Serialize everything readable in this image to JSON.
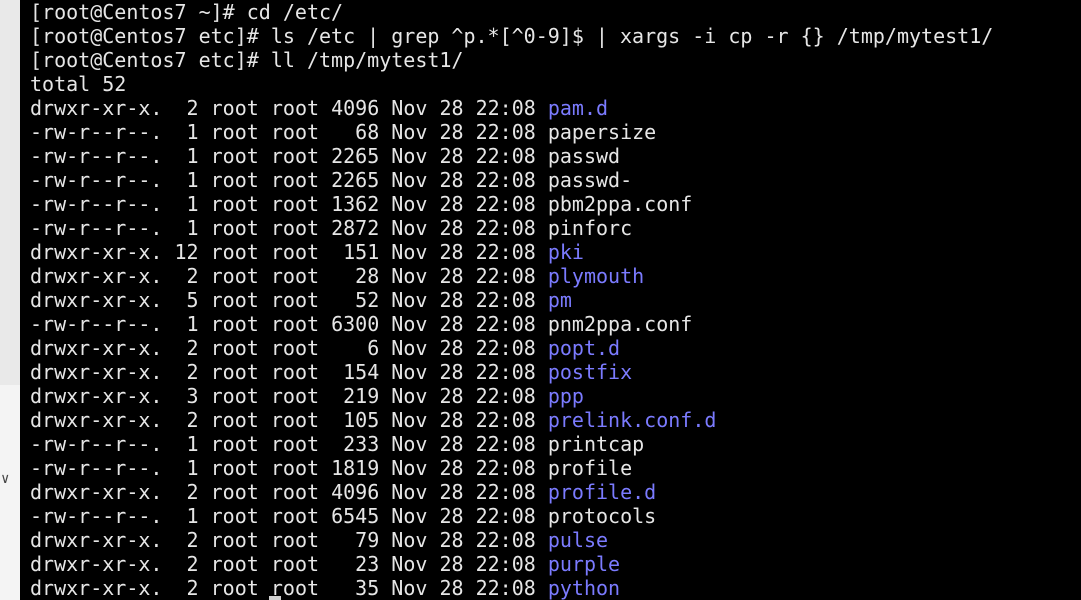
{
  "terminal": {
    "commands": [
      "[root@Centos7 ~]# cd /etc/",
      "[root@Centos7 etc]# ls /etc | grep ^p.*[^0-9]$ | xargs -i cp -r {} /tmp/mytest1/",
      "[root@Centos7 etc]# ll /tmp/mytest1/"
    ],
    "total": "total 52",
    "listing": [
      {
        "perm": "drwxr-xr-x.",
        "links": "2",
        "owner": "root",
        "group": "root",
        "size": "4096",
        "date": "Nov 28 22:08",
        "name": "pam.d",
        "type": "dir"
      },
      {
        "perm": "-rw-r--r--.",
        "links": "1",
        "owner": "root",
        "group": "root",
        "size": "68",
        "date": "Nov 28 22:08",
        "name": "papersize",
        "type": "file"
      },
      {
        "perm": "-rw-r--r--.",
        "links": "1",
        "owner": "root",
        "group": "root",
        "size": "2265",
        "date": "Nov 28 22:08",
        "name": "passwd",
        "type": "file"
      },
      {
        "perm": "-rw-r--r--.",
        "links": "1",
        "owner": "root",
        "group": "root",
        "size": "2265",
        "date": "Nov 28 22:08",
        "name": "passwd-",
        "type": "file"
      },
      {
        "perm": "-rw-r--r--.",
        "links": "1",
        "owner": "root",
        "group": "root",
        "size": "1362",
        "date": "Nov 28 22:08",
        "name": "pbm2ppa.conf",
        "type": "file"
      },
      {
        "perm": "-rw-r--r--.",
        "links": "1",
        "owner": "root",
        "group": "root",
        "size": "2872",
        "date": "Nov 28 22:08",
        "name": "pinforc",
        "type": "file"
      },
      {
        "perm": "drwxr-xr-x.",
        "links": "12",
        "owner": "root",
        "group": "root",
        "size": "151",
        "date": "Nov 28 22:08",
        "name": "pki",
        "type": "dir"
      },
      {
        "perm": "drwxr-xr-x.",
        "links": "2",
        "owner": "root",
        "group": "root",
        "size": "28",
        "date": "Nov 28 22:08",
        "name": "plymouth",
        "type": "dir"
      },
      {
        "perm": "drwxr-xr-x.",
        "links": "5",
        "owner": "root",
        "group": "root",
        "size": "52",
        "date": "Nov 28 22:08",
        "name": "pm",
        "type": "dir"
      },
      {
        "perm": "-rw-r--r--.",
        "links": "1",
        "owner": "root",
        "group": "root",
        "size": "6300",
        "date": "Nov 28 22:08",
        "name": "pnm2ppa.conf",
        "type": "file"
      },
      {
        "perm": "drwxr-xr-x.",
        "links": "2",
        "owner": "root",
        "group": "root",
        "size": "6",
        "date": "Nov 28 22:08",
        "name": "popt.d",
        "type": "dir"
      },
      {
        "perm": "drwxr-xr-x.",
        "links": "2",
        "owner": "root",
        "group": "root",
        "size": "154",
        "date": "Nov 28 22:08",
        "name": "postfix",
        "type": "dir"
      },
      {
        "perm": "drwxr-xr-x.",
        "links": "3",
        "owner": "root",
        "group": "root",
        "size": "219",
        "date": "Nov 28 22:08",
        "name": "ppp",
        "type": "dir"
      },
      {
        "perm": "drwxr-xr-x.",
        "links": "2",
        "owner": "root",
        "group": "root",
        "size": "105",
        "date": "Nov 28 22:08",
        "name": "prelink.conf.d",
        "type": "dir"
      },
      {
        "perm": "-rw-r--r--.",
        "links": "1",
        "owner": "root",
        "group": "root",
        "size": "233",
        "date": "Nov 28 22:08",
        "name": "printcap",
        "type": "file"
      },
      {
        "perm": "-rw-r--r--.",
        "links": "1",
        "owner": "root",
        "group": "root",
        "size": "1819",
        "date": "Nov 28 22:08",
        "name": "profile",
        "type": "file"
      },
      {
        "perm": "drwxr-xr-x.",
        "links": "2",
        "owner": "root",
        "group": "root",
        "size": "4096",
        "date": "Nov 28 22:08",
        "name": "profile.d",
        "type": "dir"
      },
      {
        "perm": "-rw-r--r--.",
        "links": "1",
        "owner": "root",
        "group": "root",
        "size": "6545",
        "date": "Nov 28 22:08",
        "name": "protocols",
        "type": "file"
      },
      {
        "perm": "drwxr-xr-x.",
        "links": "2",
        "owner": "root",
        "group": "root",
        "size": "79",
        "date": "Nov 28 22:08",
        "name": "pulse",
        "type": "dir"
      },
      {
        "perm": "drwxr-xr-x.",
        "links": "2",
        "owner": "root",
        "group": "root",
        "size": "23",
        "date": "Nov 28 22:08",
        "name": "purple",
        "type": "dir"
      },
      {
        "perm": "drwxr-xr-x.",
        "links": "2",
        "owner": "root",
        "group": "root",
        "size": "35",
        "date": "Nov 28 22:08",
        "name": "python",
        "type": "dir"
      }
    ]
  },
  "colors": {
    "background": "#000000",
    "text": "#e6e6e6",
    "directory": "#7b7bff"
  },
  "icons": {
    "side_toggle": "chevron-down-icon"
  }
}
